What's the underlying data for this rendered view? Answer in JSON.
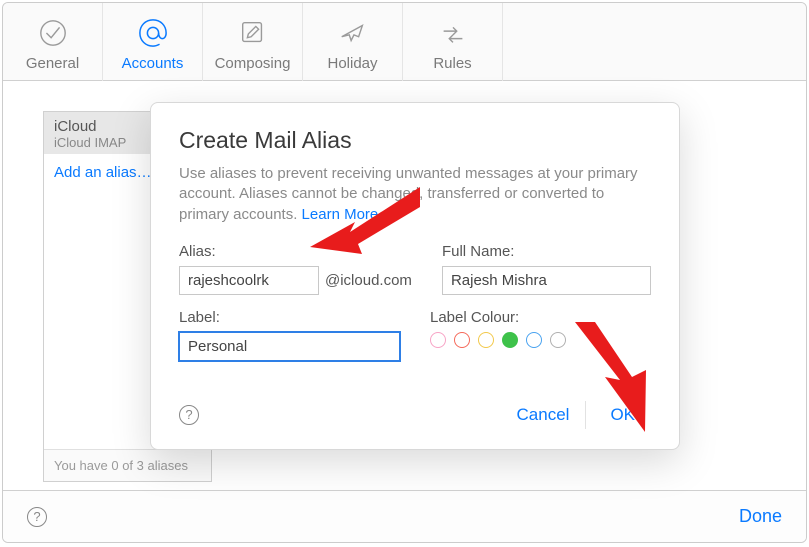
{
  "toolbar": {
    "tabs": [
      {
        "label": "General"
      },
      {
        "label": "Accounts"
      },
      {
        "label": "Composing"
      },
      {
        "label": "Holiday"
      },
      {
        "label": "Rules"
      }
    ]
  },
  "sidebar": {
    "account_name": "iCloud",
    "account_sub": "iCloud IMAP",
    "add_alias_link": "Add an alias…",
    "footer": "You have 0 of 3 aliases"
  },
  "dialog": {
    "title": "Create Mail Alias",
    "description_pre": "Use aliases to prevent receiving unwanted messages at your primary account. Aliases cannot be changed, transferred or converted to primary accounts. ",
    "learn_more": "Learn More.",
    "alias_label": "Alias:",
    "alias_value": "rajeshcoolrk",
    "alias_domain": "@icloud.com",
    "fullname_label": "Full Name:",
    "fullname_value": "Rajesh Mishra",
    "label_label": "Label:",
    "label_value": "Personal",
    "labelcolour_label": "Label Colour:",
    "colors": [
      {
        "hex": "#f7a4c6"
      },
      {
        "hex": "#f56a5b"
      },
      {
        "hex": "#f2c94c"
      },
      {
        "hex": "#3ec24a",
        "selected": true
      },
      {
        "hex": "#4aa3f0"
      },
      {
        "hex": "#b0b0b0"
      }
    ],
    "cancel": "Cancel",
    "ok": "OK"
  },
  "bottom": {
    "done": "Done"
  }
}
